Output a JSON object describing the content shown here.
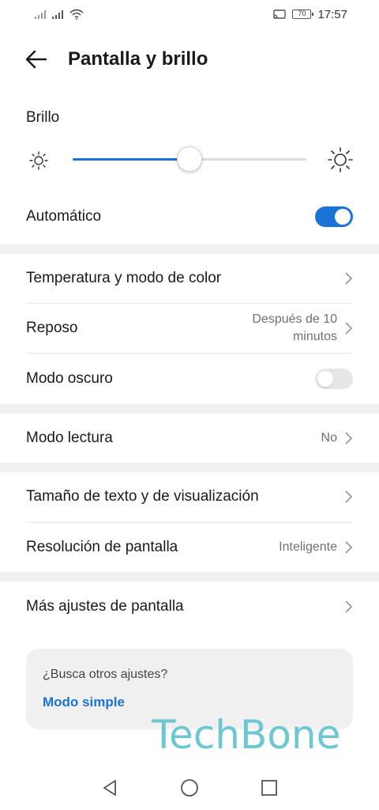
{
  "status": {
    "time": "17:57",
    "battery": "70"
  },
  "header": {
    "title": "Pantalla y brillo",
    "back_icon": "arrow-left-icon"
  },
  "brightness": {
    "label": "Brillo",
    "level_fraction": 0.5,
    "auto_label": "Automático",
    "auto_enabled": true
  },
  "items": {
    "temperature": {
      "label": "Temperatura y modo de color"
    },
    "sleep": {
      "label": "Reposo",
      "value_line1": "Después de 10",
      "value_line2": "minutos"
    },
    "dark_mode": {
      "label": "Modo oscuro",
      "enabled": false
    },
    "reading_mode": {
      "label": "Modo lectura",
      "value": "No"
    },
    "text_size": {
      "label": "Tamaño de texto y de visualización"
    },
    "resolution": {
      "label": "Resolución de pantalla",
      "value": "Inteligente"
    },
    "more": {
      "label": "Más ajustes de pantalla"
    }
  },
  "suggestion": {
    "question": "¿Busca otros ajustes?",
    "link": "Modo simple"
  },
  "watermark": "TechBone",
  "colors": {
    "accent": "#1a74d6",
    "watermark": "#6cc7d2"
  }
}
